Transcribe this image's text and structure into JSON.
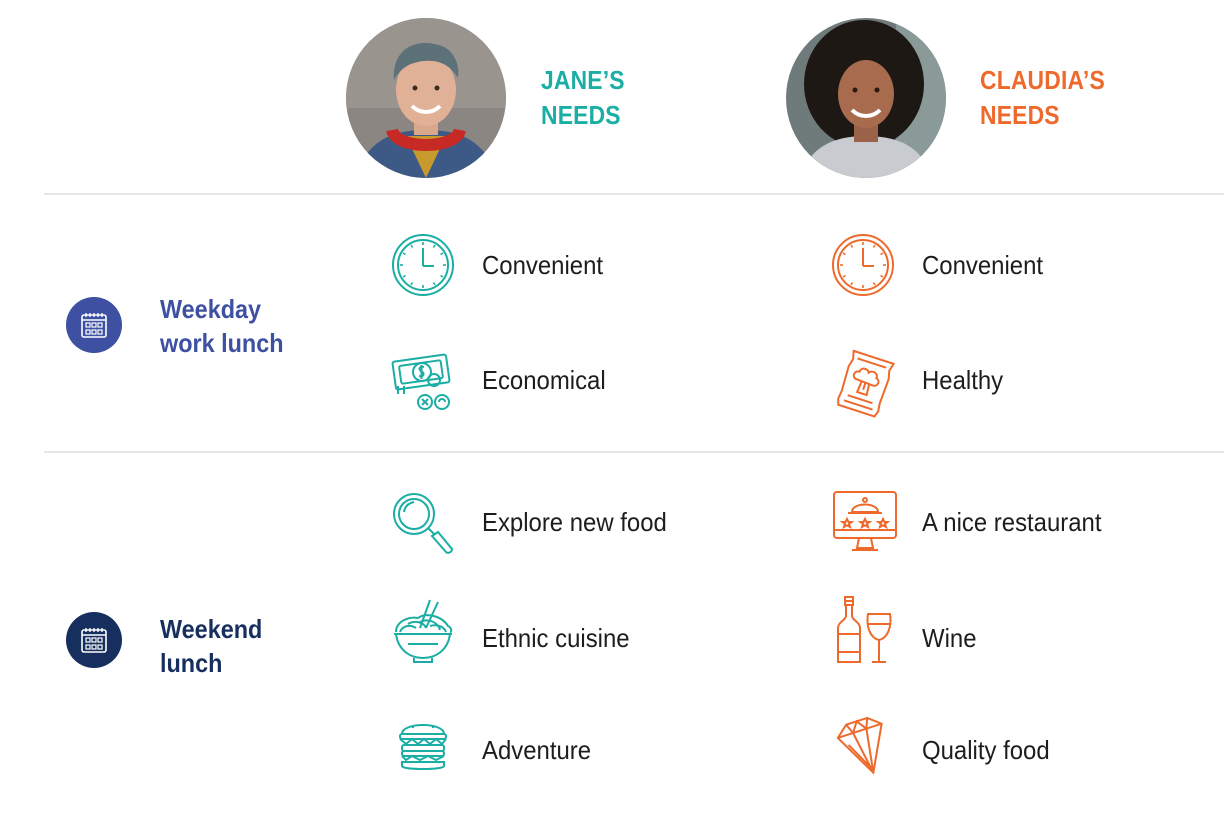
{
  "header": {
    "jane": {
      "title_line1": "JANE’S",
      "title_line2": "NEEDS",
      "avatar_icon": "jane-portrait",
      "color": "#1aaea4"
    },
    "claudia": {
      "title_line1": "CLAUDIA’S",
      "title_line2": "NEEDS",
      "avatar_icon": "claudia-portrait",
      "color": "#ee6a2c"
    }
  },
  "scenarios": [
    {
      "label_line1": "Weekday",
      "label_line2": "work lunch",
      "icon": "calendar-icon",
      "color": "#3d50a1",
      "jane_needs": [
        {
          "label": "Convenient",
          "icon": "clock-icon"
        },
        {
          "label": "Economical",
          "icon": "money-icon"
        }
      ],
      "claudia_needs": [
        {
          "label": "Convenient",
          "icon": "clock-icon"
        },
        {
          "label": "Healthy",
          "icon": "broccoli-package-icon"
        }
      ]
    },
    {
      "label_line1": "Weekend",
      "label_line2": "lunch",
      "icon": "calendar-icon",
      "color": "#172f5e",
      "jane_needs": [
        {
          "label": "Explore new food",
          "icon": "magnifier-icon"
        },
        {
          "label": "Ethnic cuisine",
          "icon": "noodle-bowl-icon"
        },
        {
          "label": "Adventure",
          "icon": "burger-icon"
        }
      ],
      "claudia_needs": [
        {
          "label": "A nice restaurant",
          "icon": "restaurant-rating-icon"
        },
        {
          "label": "Wine",
          "icon": "wine-icon"
        },
        {
          "label": "Quality food",
          "icon": "diamond-icon"
        }
      ]
    }
  ]
}
